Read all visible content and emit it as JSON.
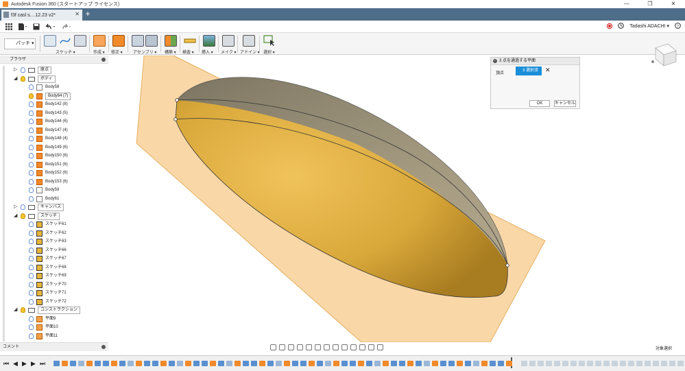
{
  "window": {
    "title": "Autodesk Fusion 360 (スタートアップ ライセンス)",
    "controls": [
      "—",
      "❐",
      "✕"
    ]
  },
  "document_tab": {
    "label": "f3f casl s....12.23  v2*",
    "close": "✕",
    "new_tab": "+"
  },
  "qat": {
    "user": "Tadashi ADACHI ▾",
    "help": "?"
  },
  "ribbon": {
    "workspace": "パッチ ▾",
    "groups": [
      "スケッチ ▾",
      "作成 ▾",
      "修正 ▾",
      "アセンブリ ▾",
      "構築 ▾",
      "検査 ▾",
      "挿入 ▾",
      "メイク ▾",
      "アドイン ▾",
      "選択 ▾"
    ]
  },
  "browser": {
    "title": "ブラウザ",
    "origin": "原点",
    "bodies_folder": "ボディ",
    "bodies": [
      "Body58",
      "Body64 (7)",
      "Body142 (8)",
      "Body143 (5)",
      "Body144 (6)",
      "Body147 (4)",
      "Body148 (4)",
      "Body149 (6)",
      "Body150 (6)",
      "Body151 (6)",
      "Body152 (6)",
      "Body153 (6)",
      "Body59",
      "Body61"
    ],
    "canvas_folder": "キャンバス",
    "sketches_folder": "スケッチ",
    "sketches": [
      "スケッチ61",
      "スケッチ62",
      "スケッチ63",
      "スケッチ66",
      "スケッチ67",
      "スケッチ68",
      "スケッチ69",
      "スケッチ70",
      "スケッチ71",
      "スケッチ72"
    ],
    "construction_folder": "コンストラクション",
    "planes": [
      "平面9",
      "平面10",
      "平面11"
    ]
  },
  "comments": {
    "label": "コメント"
  },
  "dialog": {
    "title": "3 点を通過する平面",
    "field_label": "頂点",
    "selection": "3 選択済み",
    "clear": "✕",
    "ok": "OK",
    "cancel": "キャンセル"
  },
  "status": {
    "selection_mode": "対象選択"
  },
  "colors": {
    "plane_fill": "#f7c98a",
    "plane_stroke": "#e0a24b",
    "body_gold": "#d9a83a",
    "body_gray": "#8a8a86",
    "accent_blue": "#1a8ed8",
    "tab_bar": "#4e6d88"
  }
}
